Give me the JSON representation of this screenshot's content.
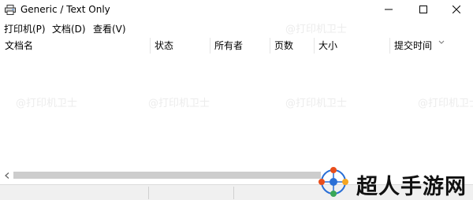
{
  "window": {
    "title": "Generic / Text Only",
    "icon": "printer-icon",
    "controls": [
      "minimize-icon",
      "maximize-icon",
      "close-icon"
    ]
  },
  "menu": [
    {
      "label": "打印机(P)"
    },
    {
      "label": "文档(D)"
    },
    {
      "label": "查看(V)"
    }
  ],
  "columns": [
    {
      "label": "文档名"
    },
    {
      "label": "状态"
    },
    {
      "label": "所有者"
    },
    {
      "label": "页数"
    },
    {
      "label": "大小"
    },
    {
      "label": "提交时间"
    }
  ],
  "sort_indicator": "chevron-down-icon",
  "watermark": "@打印机卫士",
  "logo": {
    "text": "超人手游网"
  }
}
